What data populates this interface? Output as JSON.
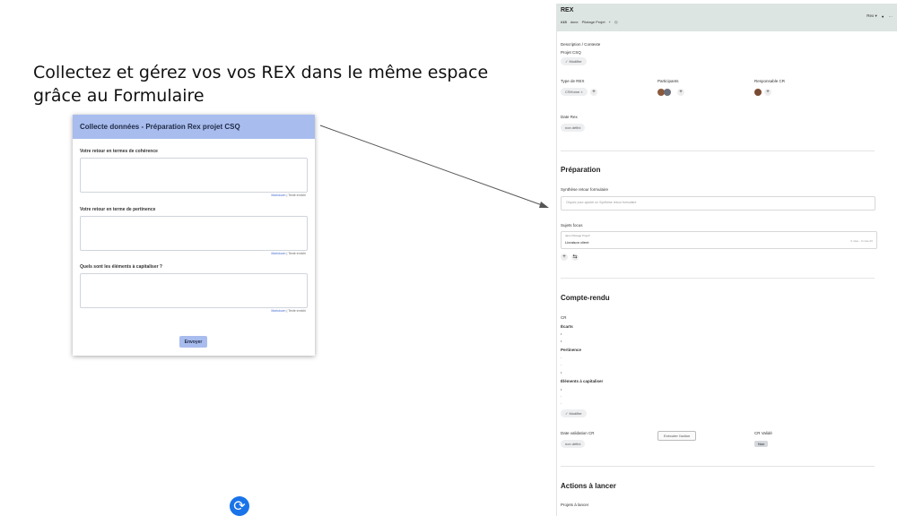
{
  "headline": {
    "line1": "Collectez et gérez vos vos REX dans le même espace",
    "line2": "grâce au Formulaire"
  },
  "form": {
    "title": "Collecte données - Préparation Rex projet CSQ",
    "questions": [
      {
        "label": "Votre retour en termes de cohérence"
      },
      {
        "label": "Votre retour en terme de pertinence"
      },
      {
        "label": "Quels sont les éléments à capitaliser ?"
      }
    ],
    "tools_left": "Markdown",
    "tools_sep": "|",
    "tools_right": "Texte enrichi",
    "submit_label": "Envoyer"
  },
  "panel": {
    "title": "REX",
    "breadcrumb": [
      "#15",
      "done",
      "Pilotage Projet"
    ],
    "user_menu": "Rex ▾",
    "description_label": "Description / Contexte",
    "description_value": "Projet CSQ",
    "edit_label": "✓ Modifier",
    "type_label": "Type de REX",
    "type_value": "CSHome ×",
    "participants_label": "Participants",
    "responsable_label": "Responsable CR",
    "date_rex_label": "Date Rex",
    "date_rex_value": "non défini",
    "prep_title": "Préparation",
    "synthese_label": "Synthèse retour formulaire",
    "synthese_placeholder": "Cliquez pour ajouter un Synthèse retour formulaire",
    "sujets_label": "Sujets focus",
    "sujets_sub": "dans Pilotage Projet*",
    "sujets_value": "Livraison client",
    "sujets_right": "0 mise - 0 mise   ≡≡",
    "cr_title": "Compte-rendu",
    "cr_label": "CR",
    "cr_items": [
      "Écarts",
      "Pertinence",
      "Éléments à capitaliser"
    ],
    "date_valid_label": "Date validation CR",
    "date_valid_value": "non défini",
    "exec_button": "Exécuter l'action",
    "cr_valide_label": "CR Validé",
    "cr_valide_value": "Non",
    "actions_title": "Actions à lancer",
    "projets_label": "Projets à lancer"
  },
  "colors": {
    "form_header": "#a8bcee",
    "topbar": "#dde5e3",
    "google_blue": "#1a73e8"
  },
  "icons": {
    "edit": "check-icon",
    "add": "plus-icon",
    "bell": "bell-icon",
    "more": "more-icon",
    "refresh": "refresh-icon"
  }
}
